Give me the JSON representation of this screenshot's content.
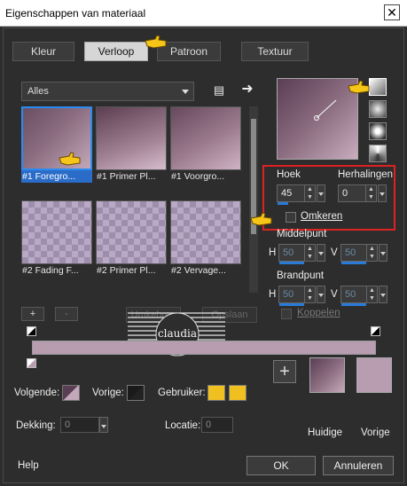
{
  "window": {
    "title": "Eigenschappen van materiaal"
  },
  "tabs": [
    {
      "label": "Kleur"
    },
    {
      "label": "Verloop"
    },
    {
      "label": "Patroon"
    },
    {
      "label": "Textuur"
    }
  ],
  "category": {
    "selected": "Alles"
  },
  "gallery": {
    "items": [
      {
        "label": "#1 Foregro..."
      },
      {
        "label": "#1 Primer Pl..."
      },
      {
        "label": "#1 Voorgro..."
      },
      {
        "label": "#2 Fading F..."
      },
      {
        "label": "#2 Primer Pl..."
      },
      {
        "label": "#2 Vervage..."
      }
    ]
  },
  "settings": {
    "angle_label": "Hoek",
    "angle_value": "45",
    "repeats_label": "Herhalingen",
    "repeats_value": "0",
    "invert_label": "Omkeren",
    "center_label": "Middelpunt",
    "center_h_label": "H",
    "center_h_value": "50",
    "center_v_label": "V",
    "center_v_value": "50",
    "focal_label": "Brandpunt",
    "focal_h_label": "H",
    "focal_h_value": "50",
    "focal_v_label": "V",
    "focal_v_value": "50",
    "link_label": "Koppelen"
  },
  "editor": {
    "add_label": "+",
    "remove_label": "-",
    "reverse_label": "Umkehren",
    "save_label": "Opslaan"
  },
  "watermark": {
    "text": "claudia"
  },
  "stops": {
    "next_label": "Volgende:",
    "prev_label": "Vorige:",
    "user_label": "Gebruiker:",
    "opacity_label": "Dekking:",
    "opacity_value": "0",
    "location_label": "Locatie:",
    "location_value": "0"
  },
  "swatches": {
    "current_label": "Huidige",
    "previous_label": "Vorige",
    "colors": {
      "current_top": "#5a3e54",
      "current_bottom": "#c3a8b9",
      "previous": "#b89caf",
      "user": "#f0c020"
    }
  },
  "footer": {
    "help_label": "Help",
    "ok_label": "OK",
    "cancel_label": "Annuleren"
  }
}
